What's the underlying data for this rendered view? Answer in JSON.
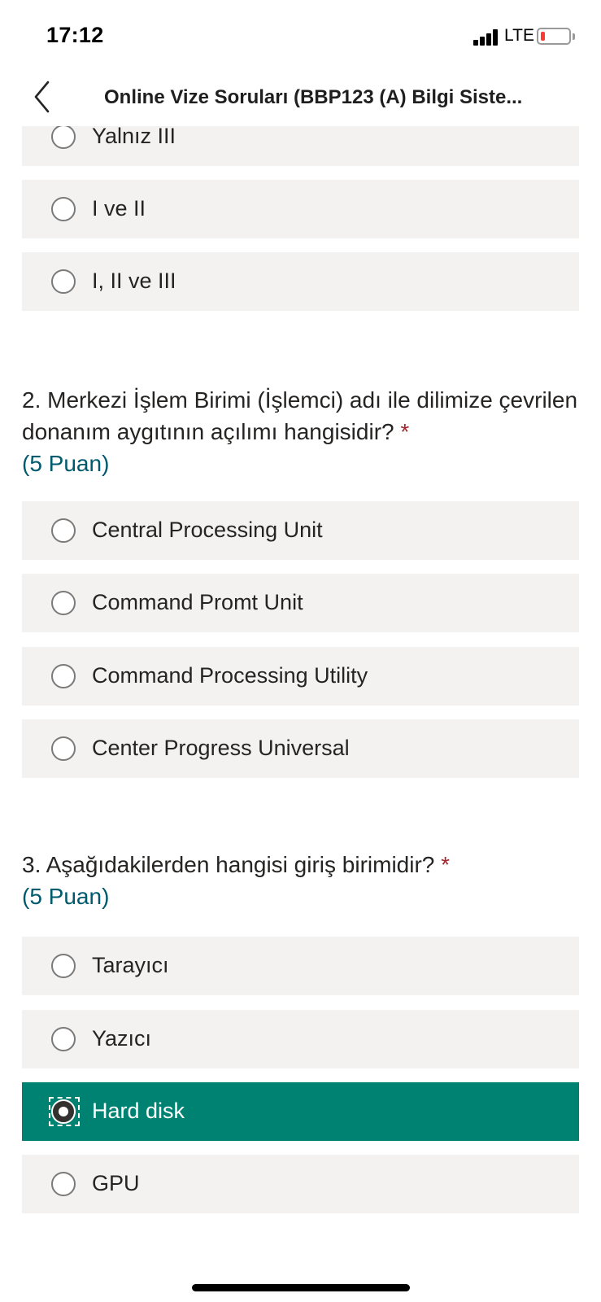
{
  "status_bar": {
    "time": "17:12",
    "network": "LTE",
    "battery_level_fraction": 0.15,
    "battery_color": "#ff3b30"
  },
  "header": {
    "back_icon": "chevron-left-icon",
    "title": "Online Vize Soruları (BBP123 (A) Bilgi Siste..."
  },
  "q1": {
    "options": [
      {
        "label": "Yalnız III",
        "selected": false
      },
      {
        "label": "I ve II",
        "selected": false
      },
      {
        "label": "I, II ve III",
        "selected": false
      }
    ]
  },
  "q2": {
    "number": "2.",
    "text": "Merkezi İşlem Birimi (İşlemci) adı ile dilimize çevrilen donanım aygıtının açılımı hangisidir?",
    "required_mark": "*",
    "points": "(5 Puan)",
    "options": [
      {
        "label": "Central Processing Unit",
        "selected": false
      },
      {
        "label": "Command Promt Unit",
        "selected": false
      },
      {
        "label": "Command Processing Utility",
        "selected": false
      },
      {
        "label": "Center Progress Universal",
        "selected": false
      }
    ]
  },
  "q3": {
    "number": "3.",
    "text": "Aşağıdakilerden hangisi giriş birimidir?",
    "required_mark": "*",
    "points": "(5 Puan)",
    "options": [
      {
        "label": "Tarayıcı",
        "selected": false
      },
      {
        "label": "Yazıcı",
        "selected": false
      },
      {
        "label": "Hard disk",
        "selected": true
      },
      {
        "label": "GPU",
        "selected": false
      }
    ]
  },
  "colors": {
    "accent": "#008272",
    "option_bg": "#f3f2f1",
    "required": "#a4262c",
    "points": "#005a6e"
  }
}
